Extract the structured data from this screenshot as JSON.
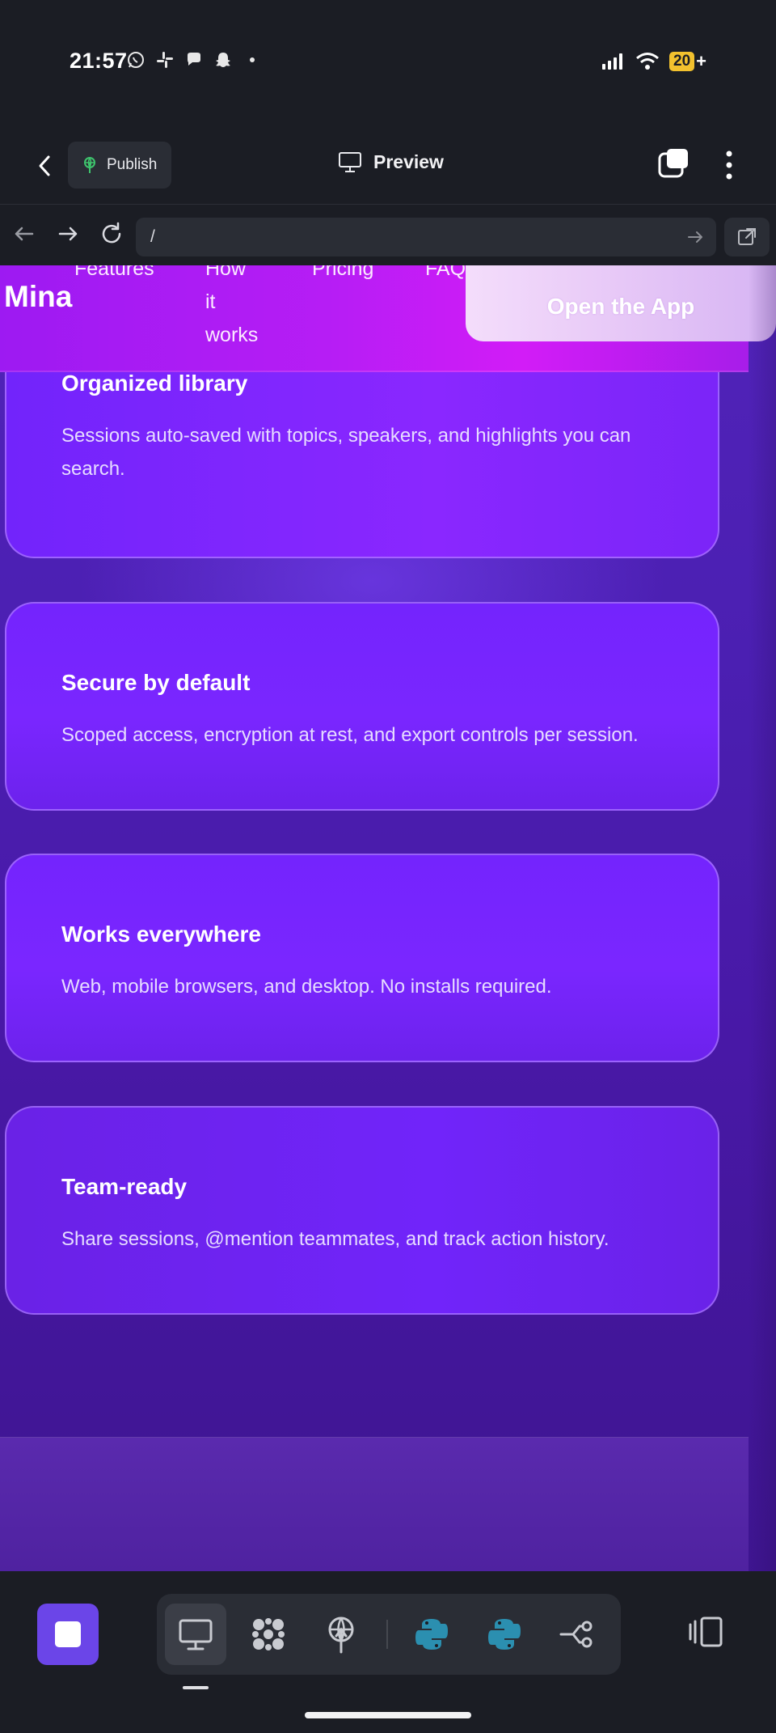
{
  "status_bar": {
    "time": "21:57",
    "notification_icons": [
      "whatsapp-icon",
      "slack-icon",
      "messages-icon",
      "snapchat-icon",
      "dot-icon"
    ],
    "battery": "20",
    "battery_plus": "+"
  },
  "toolbar": {
    "publish_label": "Publish",
    "preview_label": "Preview"
  },
  "browser": {
    "url": "/"
  },
  "site": {
    "logo": "Mina",
    "nav": {
      "features": "Features",
      "how_it_works_1": "How",
      "how_it_works_2": "it",
      "how_it_works_3": "works",
      "pricing": "Pricing",
      "faq": "FAQ"
    },
    "cta": "Open the App",
    "cards": [
      {
        "title": "Organized library",
        "desc": "Sessions auto-saved with topics, speakers, and highlights you can search."
      },
      {
        "title": "Secure by default",
        "desc": "Scoped access, encryption at rest, and export controls per session."
      },
      {
        "title": "Works everywhere",
        "desc": "Web, mobile browsers, and desktop. No installs required."
      },
      {
        "title": "Team-ready",
        "desc": "Share sessions, @mention teammates, and track action history."
      }
    ]
  },
  "colors": {
    "accent": "#6b45e8",
    "card": "#7a26ff",
    "nav_gradient_mid": "#d21cf7",
    "python": "#2b8fb0"
  },
  "dock": {
    "icons": [
      "stop-icon",
      "desktop-icon",
      "grid-apps-icon",
      "publish-antenna-icon",
      "python-icon",
      "python-icon",
      "flow-nodes-icon",
      "side-panel-icon"
    ]
  }
}
